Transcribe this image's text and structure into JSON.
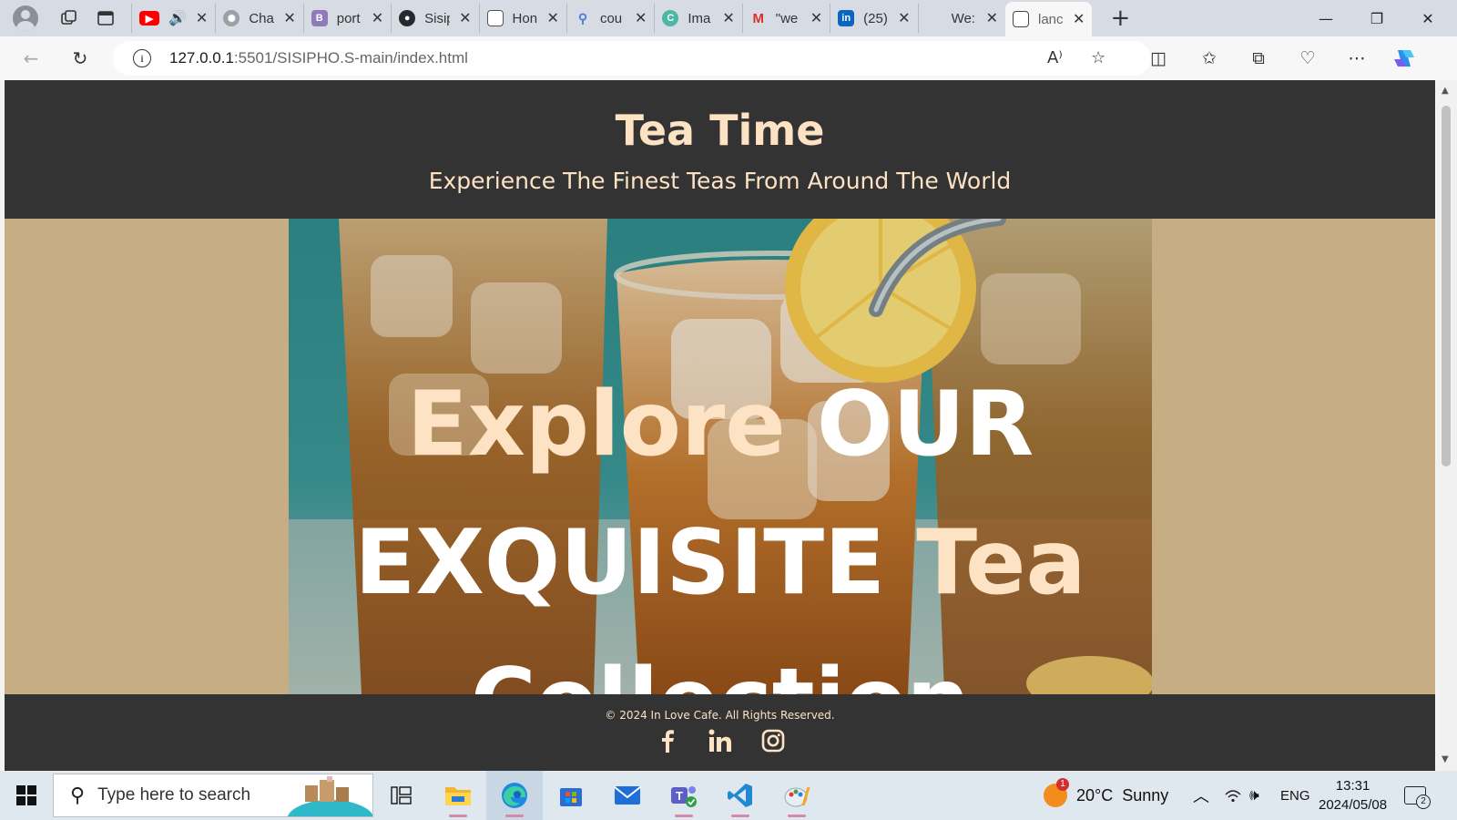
{
  "browser": {
    "tabs": [
      {
        "label": "",
        "icon": "youtube-icon",
        "color": "#ff0000"
      },
      {
        "label": "Cha",
        "icon": "chatgpt-icon",
        "color": "#9aa0a6"
      },
      {
        "label": "port",
        "icon": "bootstrap-icon",
        "color": "#7952b3"
      },
      {
        "label": "Sisip",
        "icon": "github-icon",
        "color": "#24292e"
      },
      {
        "label": "Hon",
        "icon": "page-icon",
        "color": "#555555"
      },
      {
        "label": "cou",
        "icon": "search-icon",
        "color": "#4a7bd8"
      },
      {
        "label": "Ima",
        "icon": "canva-icon",
        "color": "#4cb7a5"
      },
      {
        "label": "\"we",
        "icon": "gmail-icon",
        "color": "#d93025"
      },
      {
        "label": "(25)",
        "icon": "linkedin-icon",
        "color": "#0a66c2"
      },
      {
        "label": "We:",
        "icon": "blank-icon",
        "color": "#d7dce4"
      },
      {
        "label": "lanc",
        "icon": "page-icon",
        "color": "#555555"
      }
    ],
    "address": {
      "host": "127.0.0.1",
      "rest": ":5501/SISIPHO.S-main/index.html"
    }
  },
  "page": {
    "title": "Tea Time",
    "tagline": "Experience The Finest Teas From Around The World",
    "hero": {
      "line1_a": "Explore ",
      "line1_b": "OUR",
      "line2_a": "EXQUISITE ",
      "line2_b": "Tea",
      "line3": "Collection"
    },
    "footer": {
      "copyright": "© 2024 In Love Cafe. All Rights Reserved.",
      "socials": [
        "facebook-icon",
        "linkedin-icon",
        "instagram-icon"
      ]
    }
  },
  "taskbar": {
    "search_placeholder": "Type here to search",
    "weather": "20°C  Sunny",
    "weather_badge": "1",
    "language": "ENG",
    "time": "13:31",
    "date": "2024/05/08",
    "notifications": "2"
  },
  "colors": {
    "header_bg": "#333333",
    "accent_text": "#fde2c4",
    "hero_bg": "#c6ad83"
  }
}
